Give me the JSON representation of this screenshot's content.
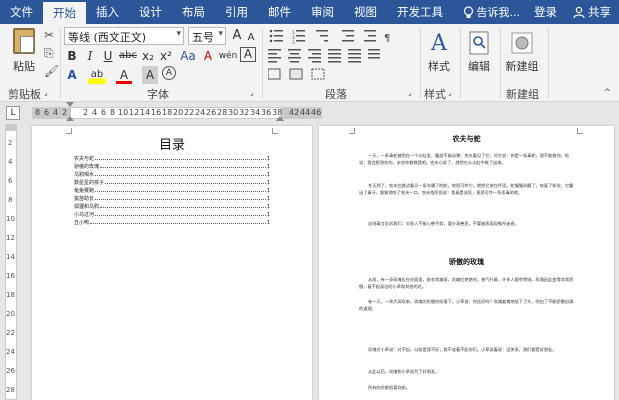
{
  "menu": {
    "tabs": [
      "文件",
      "开始",
      "插入",
      "设计",
      "布局",
      "引用",
      "邮件",
      "审阅",
      "视图",
      "开发工具"
    ],
    "active_index": 1,
    "tell_me": "告诉我...",
    "login": "登录",
    "share": "共享"
  },
  "ribbon": {
    "paste_label": "粘贴",
    "font_name": "等线 (西文正文)",
    "font_size": "五号",
    "style_label": "样式",
    "edit_label": "编辑",
    "new_group_label": "新建组",
    "groups": {
      "clipboard": "剪贴板",
      "font": "字体",
      "paragraph": "段落",
      "styles": "样式",
      "new_group": "新建组"
    },
    "font_buttons": {
      "bold": "B",
      "italic": "I",
      "underline": "U",
      "strike": "abc",
      "subscript": "x₂",
      "superscript": "x²",
      "text_effects": "A",
      "highlight": "ab",
      "font_color": "A",
      "grow": "A",
      "shrink": "A",
      "case": "Aa",
      "clear": "A",
      "phonetic": "wén",
      "border": "A"
    }
  },
  "ruler": {
    "tab_selector": "L",
    "left_numbers": [
      "8",
      "6",
      "4",
      "2"
    ],
    "right_numbers": [
      "2",
      "4",
      "6",
      "8",
      "10",
      "12",
      "14",
      "16",
      "18",
      "20",
      "22",
      "24",
      "26",
      "28",
      "30",
      "32",
      "34",
      "36",
      "38"
    ],
    "tail_numbers": [
      "42",
      "44",
      "46"
    ],
    "vertical_numbers": [
      "2",
      "4",
      "6",
      "8",
      "10",
      "12",
      "14",
      "16",
      "18",
      "20",
      "22",
      "24",
      "26",
      "28"
    ]
  },
  "toc": {
    "title": "目录",
    "entries": [
      {
        "text": "农夫与蛇",
        "page": "1"
      },
      {
        "text": "骄傲的玫瑰",
        "page": "1"
      },
      {
        "text": "乌鸦喝水",
        "page": "1"
      },
      {
        "text": "数星星的孩子",
        "page": "1"
      },
      {
        "text": "龟兔赛跑",
        "page": "1"
      },
      {
        "text": "拔苗助长",
        "page": "1"
      },
      {
        "text": "狐狸和乌鸦",
        "page": "1"
      },
      {
        "text": "小马过河",
        "page": "1"
      },
      {
        "text": "丑小鸭",
        "page": "1"
      }
    ]
  },
  "doc": {
    "heading1": "农夫与蛇",
    "p1": "一天，一条毒蛇被困在一个水缸里，腹部不能动弹，农夫看见了它，对它说：你是一条毒蛇，我不能救你。蛇说：我会报答你的，求求你救救我吧。农夫心软了，就把它从水缸中救了出来。",
    "p2": "冬天到了，农夫在路边看见一条冻僵了的蛇，他很可怜它，就把它放在怀里。蛇慢慢苏醒了，恢复了知觉，它露出了毒牙，狠狠地咬了农夫一口，农夫临死前说：我真是该死，竟然可怜一条恶毒的蛇。",
    "p3": "这则寓言告诉我们：对恶人不能心慈手软，要分清善恶，不要被表面现象所迷惑。",
    "heading2": "骄傲的玫瑰",
    "p4": "从前，有一朵玫瑰长在花园里，她非常美丽，花瓣红艳艳的，香气扑鼻，许多人都夸赞她。玫瑰因此变得非常骄傲，看不起身边的小草和其他的花。",
    "p5": "有一天，一阵大风吹来，玫瑰的花瓣纷纷落下。小草说：你还好吗？玫瑰羞愧地低下了头，明白了不能骄傲自满的道理。",
    "p6": "玫瑰对小草说：对不起，以前是我不好，我不该看不起你们。小草笑着说：没关系，我们都是好朋友。",
    "p7": "从此以后，玫瑰和小草成为了好朋友。",
    "p8": "所有的花都很喜欢她。"
  }
}
